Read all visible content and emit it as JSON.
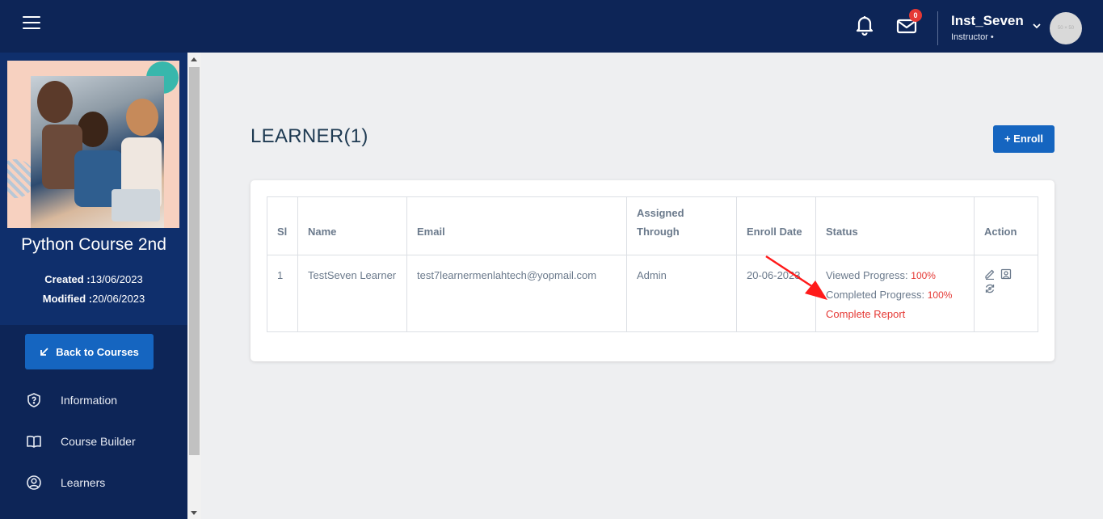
{
  "header": {
    "notifications_count": "0",
    "user_name": "Inst_Seven",
    "user_role": "Instructor •",
    "avatar_placeholder": "50 × 50"
  },
  "sidebar": {
    "course_title": "Python Course 2nd",
    "created_label": "Created :",
    "created_value": "13/06/2023",
    "modified_label": "Modified :",
    "modified_value": "20/06/2023",
    "back_button": "Back to Courses",
    "nav": [
      {
        "label": "Information",
        "icon": "shield-question-icon"
      },
      {
        "label": "Course Builder",
        "icon": "book-icon"
      },
      {
        "label": "Learners",
        "icon": "user-circle-icon"
      }
    ]
  },
  "main": {
    "title": "LEARNER(1)",
    "enroll_button": "+ Enroll",
    "table": {
      "headers": [
        "Sl",
        "Name",
        "Email",
        "Assigned Through",
        "Enroll Date",
        "Status",
        "Action"
      ],
      "rows": [
        {
          "sl": "1",
          "name": "TestSeven Learner",
          "email": "test7learnermenlahtech@yopmail.com",
          "assigned_through": "Admin",
          "enroll_date": "20-06-2023",
          "viewed_progress_label": "Viewed Progress: ",
          "viewed_progress_value": "100%",
          "completed_progress_label": "Completed Progress: ",
          "completed_progress_value": "100%",
          "report_link": "Complete Report"
        }
      ]
    }
  },
  "colors": {
    "navy": "#0d2557",
    "primary_button": "#1565c0",
    "danger": "#e53935",
    "annotation_arrow": "#ff1a1a"
  }
}
